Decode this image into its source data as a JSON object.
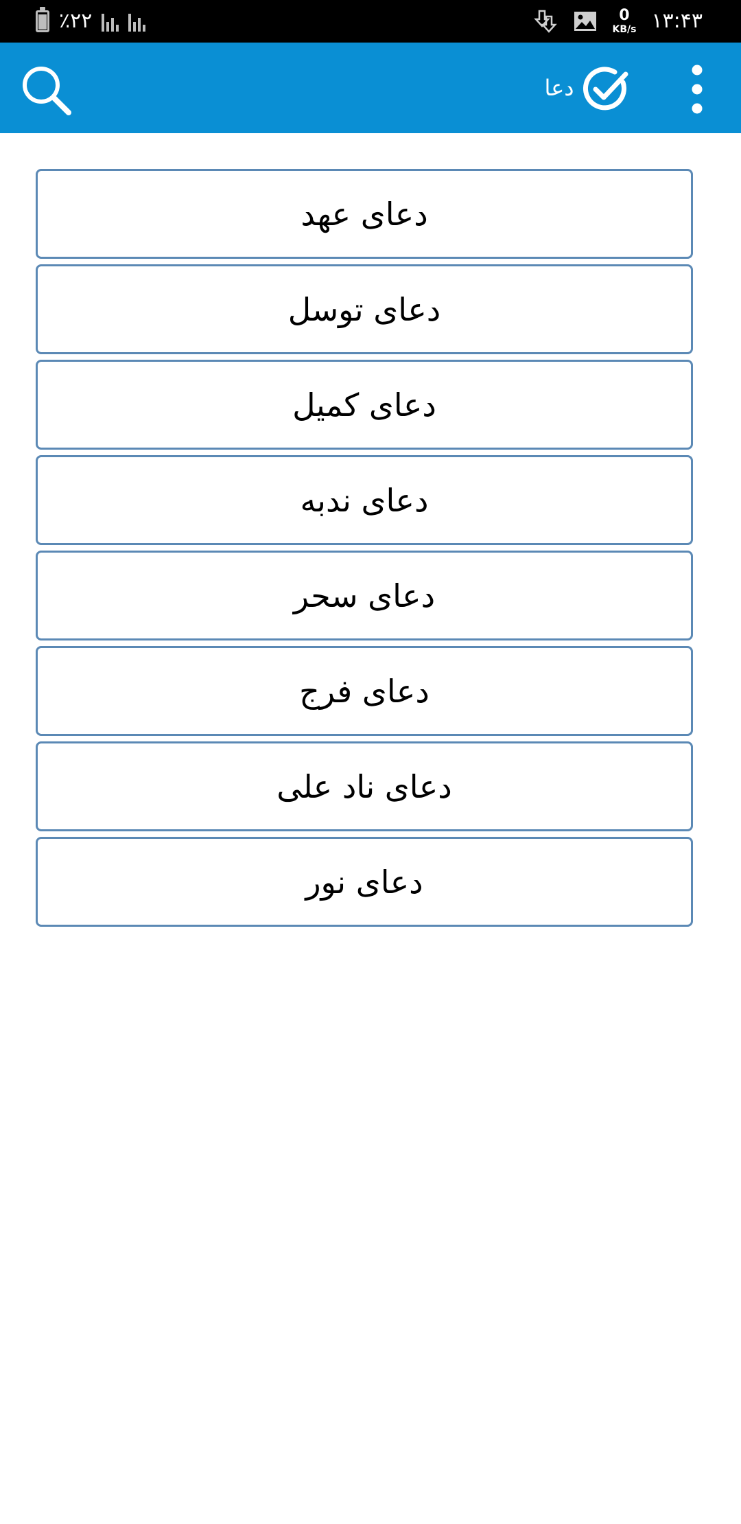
{
  "status_bar": {
    "battery_percent": "٪۲۲",
    "net_speed_value": "0",
    "net_speed_unit": "KB/s",
    "time": "۱۳:۴۳"
  },
  "app_bar": {
    "title": "دعا",
    "icons": [
      "search-icon",
      "check-circle-icon",
      "more-vert-icon"
    ],
    "background_color": "#0a8fd4"
  },
  "duas": [
    {
      "label": "دعای عهد"
    },
    {
      "label": "دعای توسل"
    },
    {
      "label": "دعای کمیل"
    },
    {
      "label": "دعای ندبه"
    },
    {
      "label": "دعای سحر"
    },
    {
      "label": "دعای فرج"
    },
    {
      "label": "دعای ناد علی"
    },
    {
      "label": "دعای نور"
    }
  ],
  "colors": {
    "item_border": "#5b89b5",
    "status_bar": "#000000"
  }
}
